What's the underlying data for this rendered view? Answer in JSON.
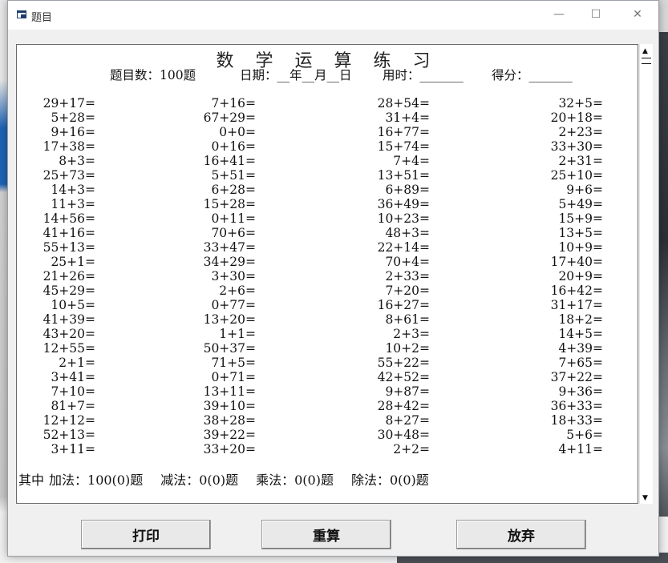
{
  "window": {
    "title": "题目"
  },
  "header": {
    "heading": "数 学 运 算 练 习",
    "count": "题目数：100题",
    "date": "日期：__年__月__日",
    "time": "用时：_______",
    "score": "得分：_______"
  },
  "columns": [
    [
      "29+17=",
      "5+28=",
      "9+16=",
      "17+38=",
      "8+3=",
      "25+73=",
      "14+3=",
      "11+3=",
      "14+56=",
      "41+16=",
      "55+13=",
      "25+1=",
      "21+26=",
      "45+29=",
      "10+5=",
      "41+39=",
      "43+20=",
      "12+55=",
      "2+1=",
      "3+41=",
      "7+10=",
      "81+7=",
      "12+12=",
      "52+13=",
      "3+11="
    ],
    [
      "7+16=",
      "67+29=",
      "0+0=",
      "0+16=",
      "16+41=",
      "5+51=",
      "6+28=",
      "15+28=",
      "0+11=",
      "70+6=",
      "33+47=",
      "34+29=",
      "3+30=",
      "2+6=",
      "0+77=",
      "13+20=",
      "1+1=",
      "50+37=",
      "71+5=",
      "0+71=",
      "13+11=",
      "39+10=",
      "38+28=",
      "39+22=",
      "33+20="
    ],
    [
      "28+54=",
      "31+4=",
      "16+77=",
      "15+74=",
      "7+4=",
      "13+51=",
      "6+89=",
      "36+49=",
      "10+23=",
      "48+3=",
      "22+14=",
      "70+4=",
      "2+33=",
      "7+20=",
      "16+27=",
      "8+61=",
      "2+3=",
      "10+2=",
      "55+22=",
      "42+52=",
      "9+87=",
      "28+42=",
      "8+27=",
      "30+48=",
      "2+2="
    ],
    [
      "32+5=",
      "20+18=",
      "2+23=",
      "33+30=",
      "2+31=",
      "25+10=",
      "9+6=",
      "5+49=",
      "15+9=",
      "13+5=",
      "10+9=",
      "17+40=",
      "20+9=",
      "16+42=",
      "31+17=",
      "18+2=",
      "14+5=",
      "4+39=",
      "7+65=",
      "37+22=",
      "9+36=",
      "36+33=",
      "18+33=",
      "5+6=",
      "4+11="
    ]
  ],
  "summary": {
    "prefix": "其中",
    "add": "加法：100(0)题",
    "sub": "减法：0(0)题",
    "mul": "乘法：0(0)题",
    "div": "除法：0(0)题"
  },
  "buttons": {
    "print": "打印",
    "regenerate": "重算",
    "cancel": "放弃"
  },
  "icons": {
    "app": "window-icon",
    "minimize": "minimize-icon",
    "maximize": "maximize-icon",
    "close": "close-icon",
    "scroll_up": "scroll-up-arrow-icon",
    "scroll_down": "scroll-down-arrow-icon"
  },
  "titlebar_symbols": {
    "minimize": "—",
    "maximize": "☐",
    "close": "✕"
  }
}
